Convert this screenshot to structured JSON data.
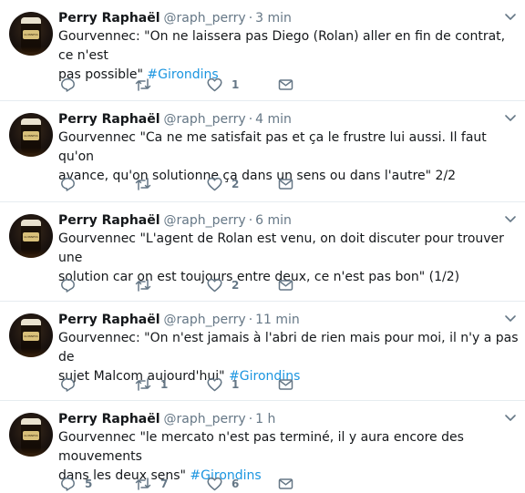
{
  "tweets": [
    {
      "name": "Perry Raphaël",
      "handle": "@raph_perry",
      "separator": "·",
      "time": "3 min",
      "text_before": "Gourvennec: \"On ne laissera pas Diego (Rolan) aller en fin de contrat, ce n'est\npas possible\" ",
      "hashtag": "#Girondins",
      "reply_count": "",
      "retweet_count": "",
      "like_count": "1"
    },
    {
      "name": "Perry Raphaël",
      "handle": "@raph_perry",
      "separator": "·",
      "time": "4 min",
      "text_before": "Gourvennec \"Ca ne me satisfait pas et ça le frustre lui aussi. Il faut qu'on\navance, qu'on solutionne ça dans un sens ou dans l'autre\" 2/2",
      "hashtag": "",
      "reply_count": "",
      "retweet_count": "",
      "like_count": "2"
    },
    {
      "name": "Perry Raphaël",
      "handle": "@raph_perry",
      "separator": "·",
      "time": "6 min",
      "text_before": "Gourvennec \"L'agent de Rolan est venu, on doit discuter pour trouver une\nsolution car on est toujours entre deux, ce n'est pas bon\" (1/2)",
      "hashtag": "",
      "reply_count": "",
      "retweet_count": "",
      "like_count": "2"
    },
    {
      "name": "Perry Raphaël",
      "handle": "@raph_perry",
      "separator": "·",
      "time": "11 min",
      "text_before": "Gourvennec: \"On n'est jamais à l'abri de rien mais pour moi, il n'y a pas de\nsujet Malcom aujourd'hui\" ",
      "hashtag": "#Girondins",
      "reply_count": "",
      "retweet_count": "1",
      "like_count": "1"
    },
    {
      "name": "Perry Raphaël",
      "handle": "@raph_perry",
      "separator": "·",
      "time": "1 h",
      "text_before": "Gourvennec \"le mercato n'est pas terminé, il y aura encore des mouvements\ndans les deux sens\" ",
      "hashtag": "#Girondins",
      "reply_count": "5",
      "retweet_count": "7",
      "like_count": "6"
    }
  ],
  "avatar_label": "GUINNESS",
  "icons": {
    "reply": "reply-icon",
    "retweet": "retweet-icon",
    "like": "heart-icon",
    "message": "envelope-icon",
    "more": "chevron-down-icon"
  },
  "colors": {
    "name": "#14171a",
    "meta": "#657786",
    "hashtag": "#1b95e0",
    "divider": "#e6ecf0"
  }
}
